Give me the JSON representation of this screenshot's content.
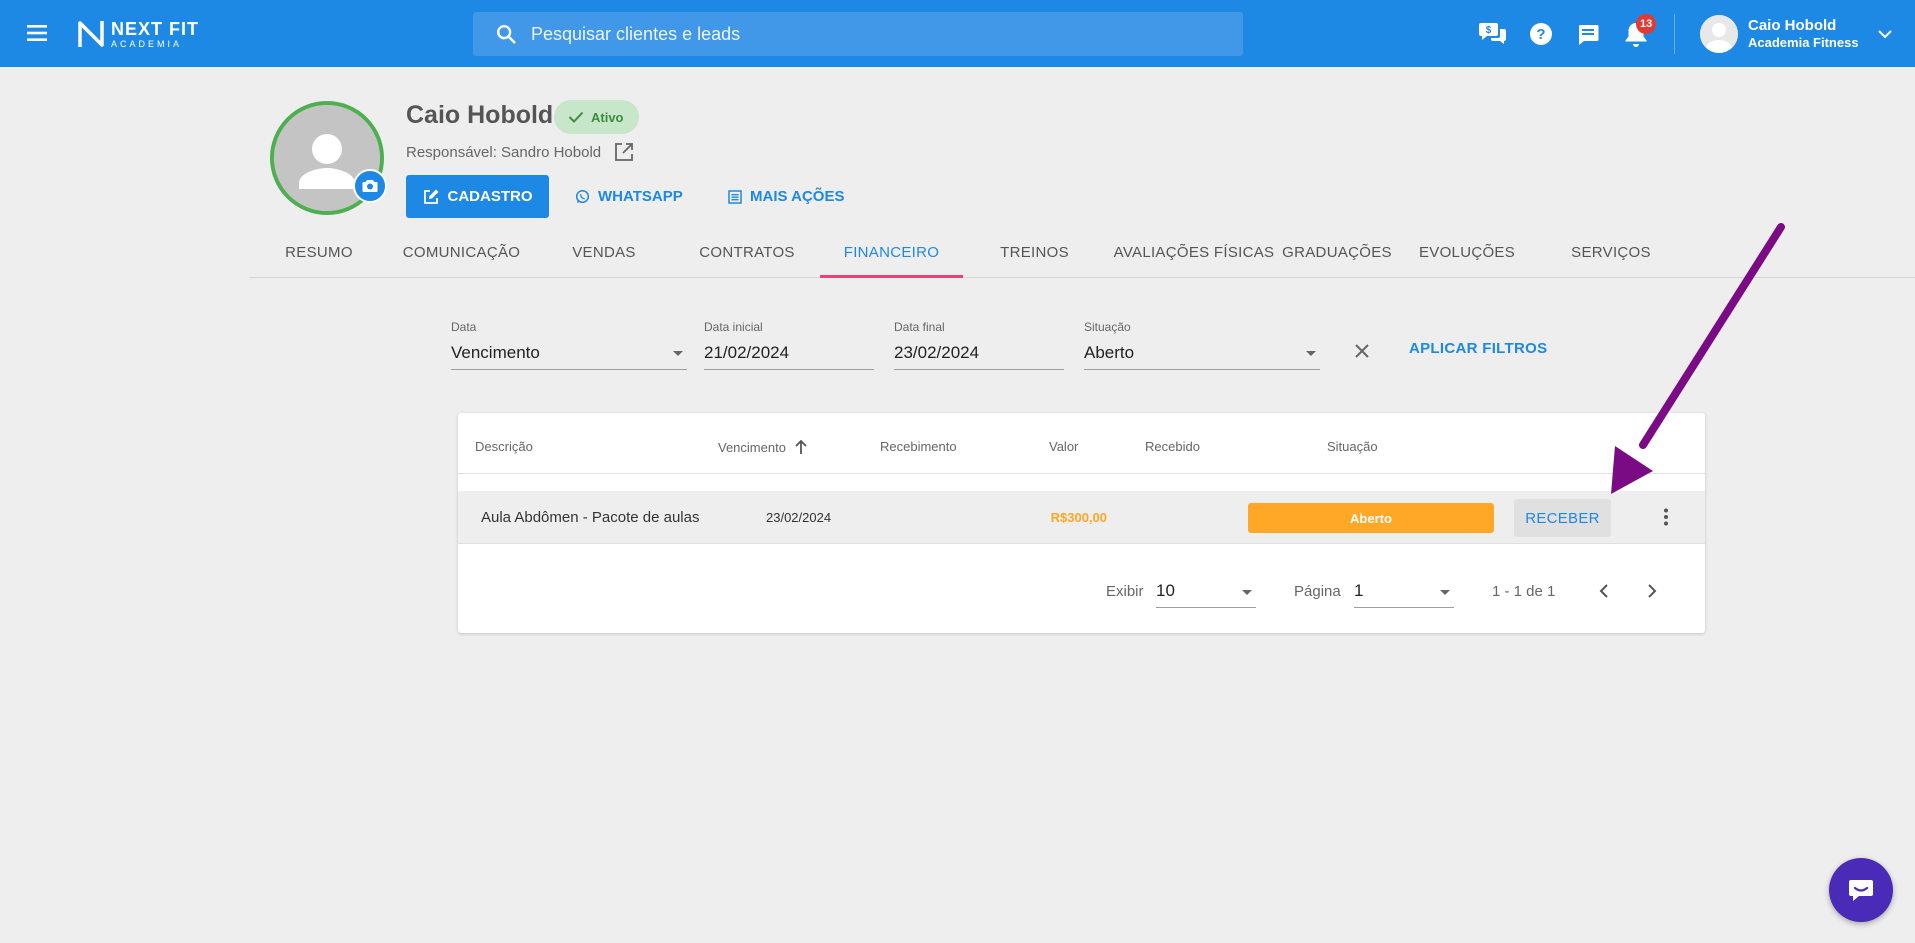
{
  "topbar": {
    "logo_name": "NEXT FIT",
    "logo_sub": "ACADEMIA",
    "search_placeholder": "Pesquisar clientes e leads",
    "notifications_count": "13",
    "user_name": "Caio Hobold",
    "user_org": "Academia Fitness"
  },
  "profile": {
    "name": "Caio Hobold",
    "status": "Ativo",
    "responsavel": "Responsável: Sandro Hobold",
    "buttons": {
      "cadastro": "CADASTRO",
      "whatsapp": "WHATSAPP",
      "mais_acoes": "MAIS AÇÕES"
    }
  },
  "tabs": [
    "RESUMO",
    "COMUNICAÇÃO",
    "VENDAS",
    "CONTRATOS",
    "FINANCEIRO",
    "TREINOS",
    "AVALIAÇÕES FÍSICAS",
    "GRADUAÇÕES",
    "EVOLUÇÕES",
    "SERVIÇOS"
  ],
  "active_tab": "FINANCEIRO",
  "filters": {
    "data": {
      "label": "Data",
      "value": "Vencimento"
    },
    "data_inicial": {
      "label": "Data inicial",
      "value": "21/02/2024"
    },
    "data_final": {
      "label": "Data final",
      "value": "23/02/2024"
    },
    "situacao": {
      "label": "Situação",
      "value": "Aberto"
    },
    "apply_label": "APLICAR FILTROS"
  },
  "table": {
    "columns": [
      "Descrição",
      "Vencimento",
      "Recebimento",
      "Valor",
      "Recebido",
      "Situação"
    ],
    "sort_column": "Vencimento",
    "rows": [
      {
        "descricao": "Aula Abdômen - Pacote de aulas",
        "vencimento": "23/02/2024",
        "recebimento": "",
        "valor": "R$300,00",
        "recebido": "",
        "situacao": "Aberto",
        "action": "RECEBER"
      }
    ]
  },
  "pagination": {
    "exibir_label": "Exibir",
    "exibir_value": "10",
    "pagina_label": "Página",
    "pagina_value": "1",
    "range": "1 - 1 de 1"
  },
  "colors": {
    "primary": "#1e88e5",
    "active_tab_indicator": "#ec407a",
    "status_active": "#4caf50",
    "status_open": "#ffa726",
    "annotation_arrow": "#7b0a85",
    "chat_fab": "#4a2bb7"
  },
  "icons": [
    "menu-icon",
    "search-icon",
    "chat-money-icon",
    "help-icon",
    "message-icon",
    "bell-icon",
    "chevron-down-icon",
    "camera-icon",
    "check-icon",
    "external-link-icon",
    "edit-icon",
    "whatsapp-icon",
    "list-icon",
    "close-icon",
    "sort-arrow-up-icon",
    "more-vert-icon",
    "chevron-left-icon",
    "chevron-right-icon",
    "chat-icon"
  ]
}
